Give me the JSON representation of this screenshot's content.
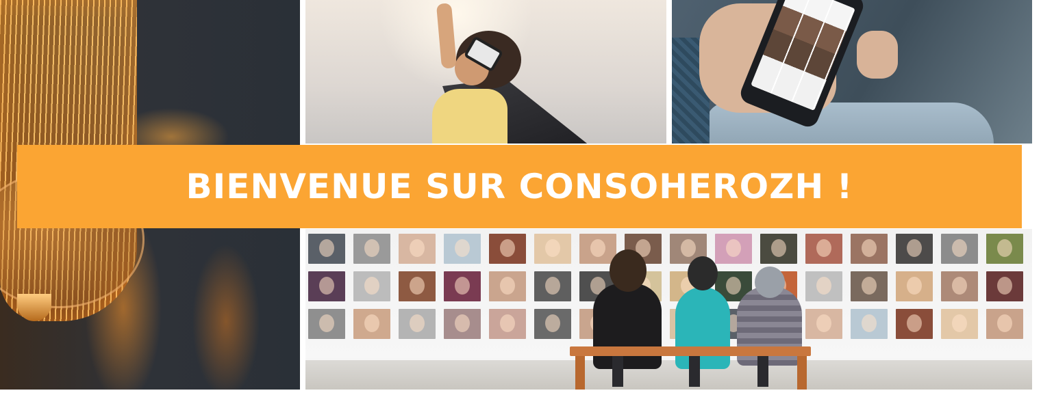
{
  "banner": {
    "title": "BIENVENUE SUR CONSOHEROZH !",
    "background_color": "#fba533",
    "text_color": "#ffffff"
  },
  "photos": [
    {
      "subject": "vintage lightbulb",
      "icon": "lightbulb-photo"
    },
    {
      "subject": "child superhero with cape and goggles",
      "icon": "superhero-photo"
    },
    {
      "subject": "hand holding smartphone",
      "icon": "smartphone-photo"
    },
    {
      "subject": "people on bench facing wall of faces",
      "icon": "faces-wall-photo"
    }
  ],
  "face_tile_colors": [
    "#5a6068",
    "#9a9a9a",
    "#d8b7a2",
    "#b9c9d4",
    "#8a4d3a",
    "#e3c8a8",
    "#c9a38b",
    "#7a5c4c",
    "#a08778",
    "#d3a0b8",
    "#4b4b40",
    "#b06a5a",
    "#9b7463",
    "#4d4b4a",
    "#8c8c8c",
    "#7a8a4c",
    "#5a3e56",
    "#bcbcbc",
    "#8e5a42",
    "#7a3b52",
    "#caa58e",
    "#5f5f5f",
    "#4f4f4f",
    "#d4c39b",
    "#d3b68a",
    "#3a4b3a",
    "#c4653a",
    "#c0c0c0",
    "#7a6a5e",
    "#d6b08a",
    "#ad8a78",
    "#6b3a3a",
    "#8f8f8f",
    "#cfa98e",
    "#b4b4b4",
    "#a78d8d",
    "#caa59a",
    "#6a6a6a",
    "#c9a58e",
    "#567a66",
    "#d9c3a4"
  ]
}
